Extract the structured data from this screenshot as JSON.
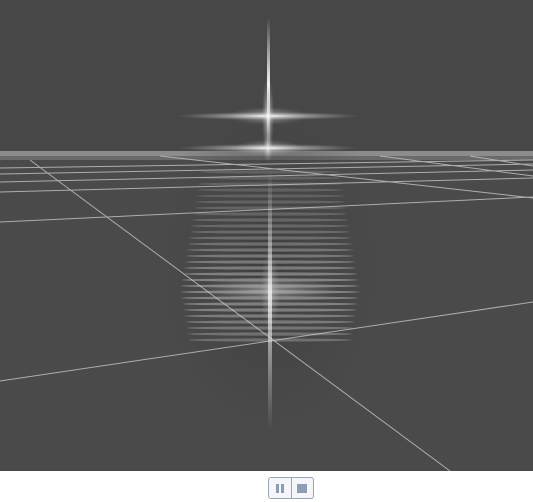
{
  "scene": {
    "background_color": "#474747",
    "floor_color": "#4c4c4c",
    "grid_line_color": "#b5b5b5",
    "horizon_band_color": "#8f8f8f",
    "glow_color": "#ffffff"
  },
  "controls": {
    "pause": {
      "icon": "pause-icon"
    },
    "stop": {
      "icon": "stop-icon"
    }
  }
}
